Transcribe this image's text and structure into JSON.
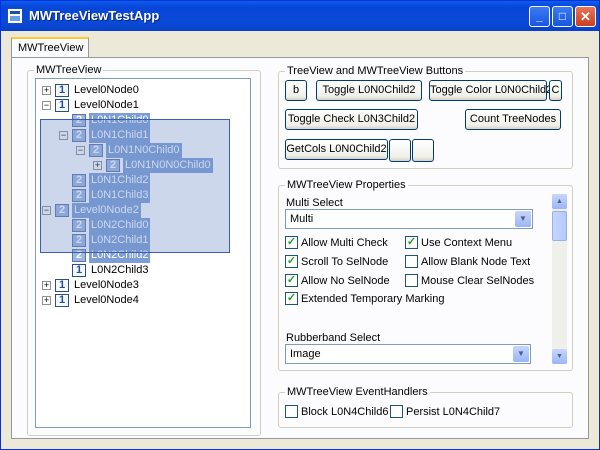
{
  "window": {
    "title": "MWTreeViewTestApp",
    "min_glyph": "_",
    "max_glyph": "□",
    "close_glyph": "✕"
  },
  "tabs": [
    {
      "label": "MWTreeView"
    }
  ],
  "tree_group": {
    "label": "MWTreeView",
    "nodes": [
      {
        "text": "Level0Node0",
        "icon": "1",
        "expander": "+"
      },
      {
        "text": "Level0Node1",
        "icon": "1",
        "expander": "−"
      },
      {
        "text": "L0N1Child0",
        "icon": "2",
        "selected": true
      },
      {
        "text": "L0N1Child1",
        "icon": "2",
        "expander": "−",
        "selected": true
      },
      {
        "text": "L0N1N0Child0",
        "icon": "2",
        "expander": "−",
        "selected": true
      },
      {
        "text": "L0N1N0N0Child0",
        "icon": "2",
        "expander": "+",
        "selected": true
      },
      {
        "text": "L0N1Child2",
        "icon": "2",
        "selected": true
      },
      {
        "text": "L0N1Child3",
        "icon": "2",
        "selected": true
      },
      {
        "text": "Level0Node2",
        "icon": "2",
        "expander": "−",
        "selected": true
      },
      {
        "text": "L0N2Child0",
        "icon": "2",
        "selected": true
      },
      {
        "text": "L0N2Child1",
        "icon": "2",
        "selected": true
      },
      {
        "text": "L0N2Child2",
        "icon": "2",
        "selected": true
      },
      {
        "text": "L0N2Child3",
        "icon": "1"
      },
      {
        "text": "Level0Node3",
        "icon": "1",
        "expander": "+"
      },
      {
        "text": "Level0Node4",
        "icon": "1",
        "expander": "+"
      }
    ]
  },
  "buttons_group": {
    "label": "TreeView and MWTreeView Buttons",
    "b": "b",
    "toggle_l0n0child2": "Toggle L0N0Child2",
    "toggle_color": "Toggle Color L0N0Child2",
    "c": "C",
    "toggle_check": "Toggle Check L0N3Child2",
    "count_treenodes": "Count TreeNodes",
    "getcols": "GetCols L0N0Child2",
    "blank1": "",
    "blank2": ""
  },
  "props_group": {
    "label": "MWTreeView Properties",
    "multi_select_label": "Multi Select",
    "multi_select_value": "Multi",
    "checks": {
      "allow_multi_check": {
        "label": "Allow Multi Check",
        "checked": true
      },
      "use_context_menu": {
        "label": "Use Context Menu",
        "checked": true
      },
      "scroll_to_selnode": {
        "label": "Scroll To SelNode",
        "checked": true
      },
      "allow_blank_node_text": {
        "label": "Allow Blank Node Text",
        "checked": false
      },
      "allow_no_selnode": {
        "label": "Allow No SelNode",
        "checked": true
      },
      "mouse_clear_selnodes": {
        "label": "Mouse Clear SelNodes",
        "checked": false
      },
      "extended_temp_marking": {
        "label": "Extended Temporary Marking",
        "checked": true
      }
    },
    "rubberband_label": "Rubberband Select",
    "rubberband_value": "Image",
    "check_glyph": "✓"
  },
  "events_group": {
    "label": "MWTreeView EventHandlers",
    "block": {
      "label": "Block L0N4Child6",
      "checked": false
    },
    "persist": {
      "label": "Persist L0N4Child7",
      "checked": false
    }
  }
}
